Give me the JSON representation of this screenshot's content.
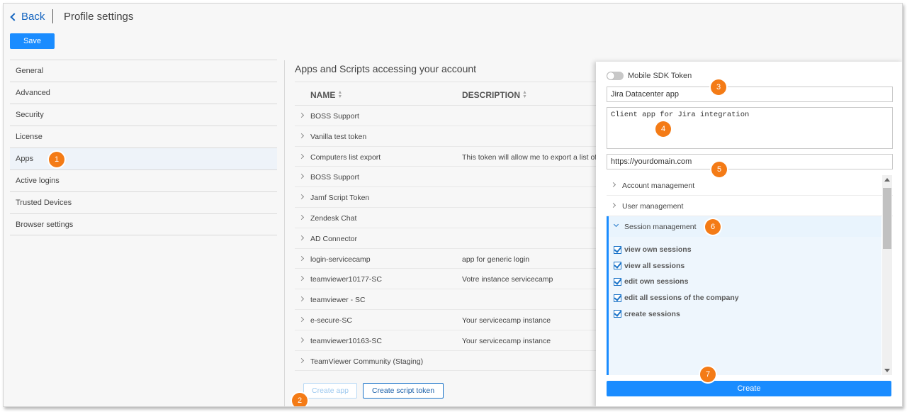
{
  "header": {
    "back_label": "Back",
    "page_title": "Profile settings",
    "save_label": "Save"
  },
  "sidebar": {
    "items": [
      {
        "label": "General"
      },
      {
        "label": "Advanced"
      },
      {
        "label": "Security"
      },
      {
        "label": "License"
      },
      {
        "label": "Apps",
        "active": true
      },
      {
        "label": "Active logins"
      },
      {
        "label": "Trusted Devices"
      },
      {
        "label": "Browser settings"
      }
    ]
  },
  "main": {
    "title": "Apps and Scripts accessing your account",
    "columns": {
      "name": "NAME",
      "description": "DESCRIPTION"
    },
    "rows": [
      {
        "name": "BOSS Support",
        "description": ""
      },
      {
        "name": "Vanilla test token",
        "description": ""
      },
      {
        "name": "Computers list export",
        "description": "This token will allow me to export a list of r"
      },
      {
        "name": "BOSS Support",
        "description": ""
      },
      {
        "name": "Jamf Script Token",
        "description": ""
      },
      {
        "name": "Zendesk Chat",
        "description": ""
      },
      {
        "name": "AD Connector",
        "description": ""
      },
      {
        "name": "login-servicecamp",
        "description": "app for generic login"
      },
      {
        "name": "teamviewer10177-SC",
        "description": "Votre instance servicecamp"
      },
      {
        "name": "teamviewer - SC",
        "description": ""
      },
      {
        "name": "e-secure-SC",
        "description": "Your servicecamp instance"
      },
      {
        "name": "teamviewer10163-SC",
        "description": "Your servicecamp instance"
      },
      {
        "name": "TeamViewer Community (Staging)",
        "description": ""
      }
    ],
    "create_app_label": "Create app",
    "create_script_token_label": "Create script token"
  },
  "panel": {
    "mobile_sdk_label": "Mobile SDK Token",
    "mobile_sdk_enabled": false,
    "app_name_value": "Jira Datacenter app",
    "description_value": "Client app for Jira integration",
    "url_value": "https://yourdomain.com",
    "collapsed_groups": [
      {
        "label": "Account management"
      },
      {
        "label": "User management"
      }
    ],
    "expanded_group": {
      "label": "Session management",
      "permissions": [
        {
          "label": "view own sessions",
          "checked": true
        },
        {
          "label": "view all sessions",
          "checked": true
        },
        {
          "label": "edit own sessions",
          "checked": true
        },
        {
          "label": "edit all sessions of the company",
          "checked": true
        },
        {
          "label": "create sessions",
          "checked": true
        }
      ]
    },
    "create_label": "Create"
  },
  "callouts": [
    "1",
    "2",
    "3",
    "4",
    "5",
    "6",
    "7"
  ],
  "colors": {
    "accent": "#1a8cff",
    "callout": "#f47b16",
    "link": "#1565c0"
  }
}
